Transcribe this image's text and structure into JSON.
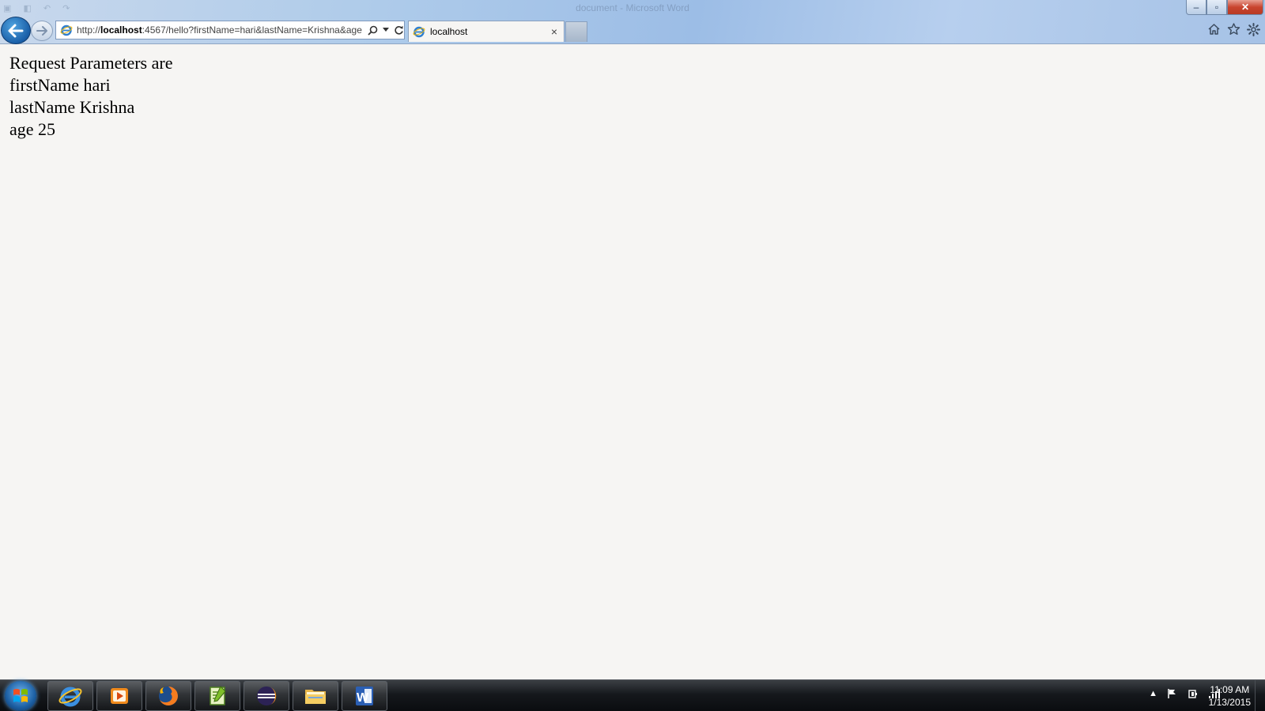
{
  "window": {
    "title_faded": "document - Microsoft Word",
    "minimize_label": "–",
    "restore_label": "▫",
    "close_label": "✕"
  },
  "address_bar": {
    "url_prefix": "http://",
    "url_host": "localhost",
    "url_rest": ":4567/hello?firstName=hari&lastName=Krishna&age"
  },
  "tab": {
    "title": "localhost",
    "close_label": "×"
  },
  "content": {
    "lines": [
      "Request Parameters are",
      "firstName hari",
      "lastName Krishna",
      "age 25"
    ]
  },
  "taskbar": {
    "apps": [
      "internet-explorer",
      "media-player",
      "firefox",
      "notepad-plus-plus",
      "eclipse",
      "file-explorer",
      "microsoft-word"
    ],
    "clock_time": "11:09 AM",
    "clock_date": "1/13/2015"
  },
  "colors": {
    "accent": "#1a5fa8",
    "page_bg": "#f6f5f3",
    "taskbar": "#15181c"
  }
}
